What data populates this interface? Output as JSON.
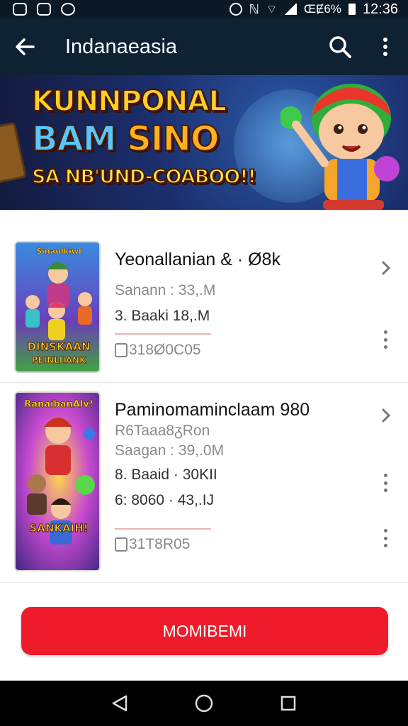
{
  "status_bar": {
    "battery": "ŒɆ6%",
    "time": "12:36",
    "icons": [
      "gallery-icon",
      "app-icon",
      "messenger-icon",
      "alarm-icon",
      "nfc-icon",
      "wifi-icon",
      "signal-icon",
      "battery-icon"
    ]
  },
  "app_bar": {
    "title": "Indanaeasia",
    "icons": [
      "back-arrow-icon",
      "search-icon",
      "more-vert-icon"
    ]
  },
  "banner": {
    "line1": "KUNNPONAL",
    "line2a": "BAM ",
    "line2b": "SINO",
    "line3": "SA NB'UND-COABOO!!"
  },
  "games": [
    {
      "thumb_line1": "Sinaulkiwl",
      "thumb_line2": "DINSKAAN",
      "thumb_line3": "PEINLIIANK",
      "title": "Yeonallanian & · Ø8k",
      "meta1": "Sanann : 33,.M",
      "meta2": "3. Baaki   18,.M",
      "code": "318Ø0C05"
    },
    {
      "thumb_line1": "RanaibanAlv!",
      "thumb_line2": "SANKAIH!",
      "title": "Paminomaminclaam 980",
      "meta1": "R6Taaa8ᵹRon",
      "meta2": "Saagan : 39,.0M",
      "meta3": "8. Baaid · 30KII",
      "meta4": "6: 8060 · 43,.IJ",
      "code": "31T8R05"
    }
  ],
  "main_button": {
    "label": "MOMIBEMI"
  },
  "nav": {
    "icons": [
      "back-triangle-icon",
      "home-circle-icon",
      "recents-square-icon"
    ]
  },
  "colors": {
    "app_bar": "#0f2233",
    "accent_button": "#ee1b2a",
    "status_bar": "#0b1826"
  }
}
